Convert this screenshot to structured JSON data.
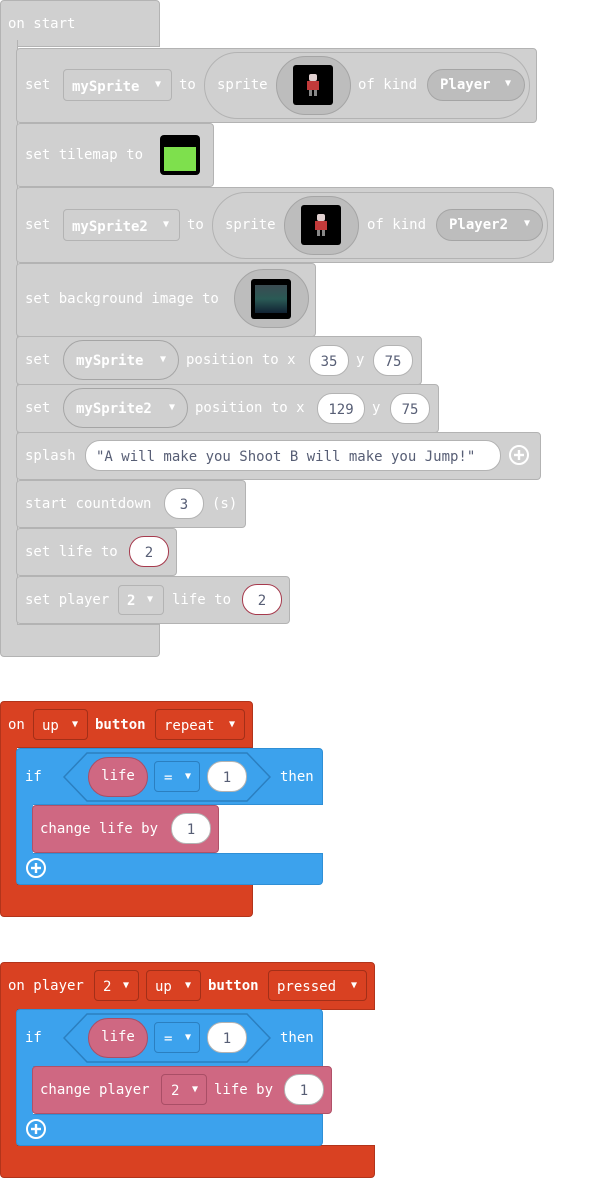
{
  "colors": {
    "scene": "#d0d0d0",
    "controller": "#d94122",
    "logic": "#3ca2ed",
    "info": "#cf6882",
    "text_dark": "#575e75",
    "tilemap_green": "#7ee04d"
  },
  "on_start": {
    "label": "on start",
    "set_sprite": {
      "set": "set",
      "variable": "mySprite",
      "to": "to",
      "sprite": "sprite",
      "of_kind": "of kind",
      "kind": "Player"
    },
    "set_tilemap": {
      "label": "set tilemap to"
    },
    "set_sprite2": {
      "set": "set",
      "variable": "mySprite2",
      "to": "to",
      "sprite": "sprite",
      "of_kind": "of kind",
      "kind": "Player2"
    },
    "set_background": {
      "label": "set background image to"
    },
    "position1": {
      "set": "set",
      "variable": "mySprite",
      "position_to_x": "position to x",
      "x": "35",
      "y_label": "y",
      "y": "75"
    },
    "position2": {
      "set": "set",
      "variable": "mySprite2",
      "position_to_x": "position to x",
      "x": "129",
      "y_label": "y",
      "y": "75"
    },
    "splash": {
      "label": "splash",
      "text": "\"A will make you Shoot B will make you Jump!\""
    },
    "countdown": {
      "label": "start countdown",
      "value": "3",
      "unit": "(s)"
    },
    "set_life": {
      "label": "set life to",
      "value": "2"
    },
    "set_player_life": {
      "set_player": "set player",
      "player": "2",
      "life_to": "life to",
      "value": "2"
    }
  },
  "event1": {
    "on": "on",
    "button": "up",
    "button_label": "button",
    "event": "repeat",
    "if_label": "if",
    "variable": "life",
    "operator": "=",
    "value": "1",
    "then": "then",
    "change": "change life by",
    "change_value": "1"
  },
  "event2": {
    "on_player": "on player",
    "player": "2",
    "button": "up",
    "button_label": "button",
    "event": "pressed",
    "if_label": "if",
    "variable": "life",
    "operator": "=",
    "value": "1",
    "then": "then",
    "change_player": "change player",
    "change_player_num": "2",
    "life_by": "life by",
    "change_value": "1"
  },
  "icons": {
    "dropdown": "triangle-down",
    "add": "circle-plus",
    "sprite_image": "player-sprite-thumbnail",
    "tilemap_image": "tilemap-thumbnail",
    "background_image": "background-thumbnail"
  }
}
